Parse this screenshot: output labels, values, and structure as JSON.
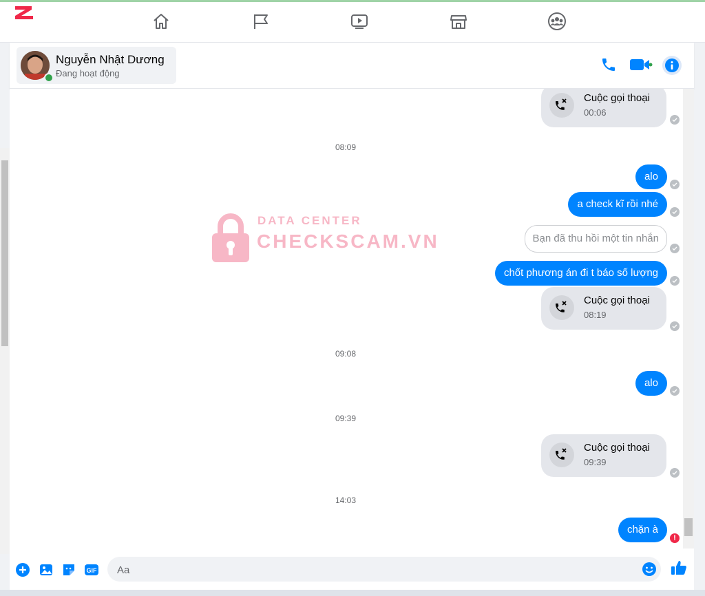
{
  "contact": {
    "name": "Nguyễn Nhật Dương",
    "status": "Đang hoạt động"
  },
  "watermark": {
    "line1": "DATA CENTER",
    "line2": "CHECKSCAM.VN"
  },
  "messages": {
    "call1": {
      "title": "Cuộc gọi thoại",
      "duration": "00:06"
    },
    "time1": "08:09",
    "msg_alo1": "alo",
    "msg_check": "a check kĩ rồi nhé",
    "recalled": "Bạn đã thu hồi một tin nhắn",
    "msg_chot": "chốt phương án đi t báo số lượng",
    "call2": {
      "title": "Cuộc gọi thoại",
      "duration": "08:19"
    },
    "time2": "09:08",
    "msg_alo2": "alo",
    "time3": "09:39",
    "call3": {
      "title": "Cuộc gọi thoại",
      "duration": "09:39"
    },
    "time4": "14:03",
    "msg_chan": "chặn à",
    "error_mark": "!"
  },
  "composer": {
    "placeholder": "Aa"
  },
  "colors": {
    "accent": "#0084ff",
    "online": "#31a24c",
    "error": "#f02849",
    "watermark": "#f7b7c6"
  },
  "icons": [
    "home-icon",
    "flag-icon",
    "video-play-icon",
    "marketplace-icon",
    "groups-icon",
    "phone-icon",
    "video-camera-icon",
    "info-icon",
    "plus-icon",
    "image-icon",
    "sticker-icon",
    "gif-icon",
    "emoji-icon",
    "like-icon",
    "missed-call-icon",
    "sent-check-icon",
    "error-icon",
    "lock-icon"
  ]
}
